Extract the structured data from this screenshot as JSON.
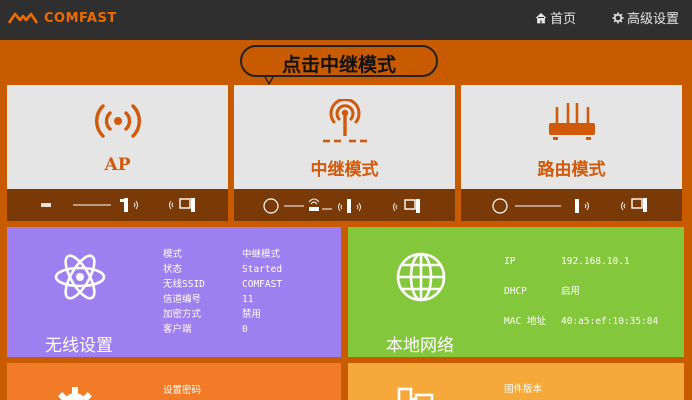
{
  "header": {
    "brand": "COMFAST",
    "nav": {
      "home": "首页",
      "advanced": "高级设置"
    }
  },
  "callout": {
    "text": "点击中继模式"
  },
  "modes": [
    {
      "label": "AP",
      "icon": "wifi-signal-icon"
    },
    {
      "label": "中继模式",
      "icon": "repeater-antenna-icon"
    },
    {
      "label": "路由模式",
      "icon": "router-icon"
    }
  ],
  "wireless": {
    "title": "无线设置",
    "icon": "atom-icon",
    "fields": [
      {
        "key": "模式",
        "value": "中继模式"
      },
      {
        "key": "状态",
        "value": "Started"
      },
      {
        "key": "无线SSID",
        "value": "COMFAST"
      },
      {
        "key": "信道编号",
        "value": "11"
      },
      {
        "key": "加密方式",
        "value": "禁用"
      },
      {
        "key": "客户端",
        "value": "0"
      }
    ]
  },
  "lan": {
    "title": "本地网络",
    "icon": "globe-icon",
    "fields": [
      {
        "key": "IP",
        "value": "192.168.10.1"
      },
      {
        "key": "DHCP",
        "value": "启用"
      },
      {
        "key": "MAC 地址",
        "value": "40:a5:ef:10:35:84"
      }
    ]
  },
  "system": {
    "items": [
      "设置密码"
    ],
    "icon": "gear-icon"
  },
  "firmware": {
    "items": [
      "固件版本"
    ],
    "icon": "device-icon"
  },
  "colors": {
    "header": "#2f2f2f",
    "page": "#c85a00",
    "brand": "#ef6b00",
    "wireless": "#9e7ff0",
    "lan": "#84c73c",
    "system": "#f27b28",
    "firmware": "#f4a93a"
  }
}
